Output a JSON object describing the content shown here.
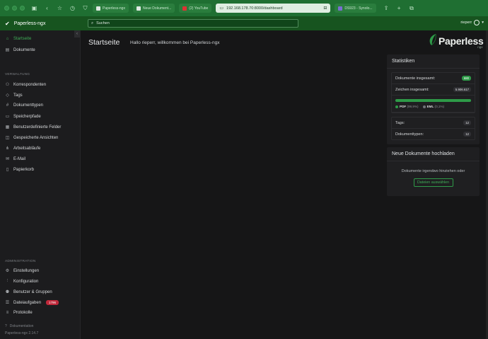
{
  "browser": {
    "tabs": [
      {
        "label": "Paperless-ngx",
        "kind": "paperless"
      },
      {
        "label": "Neue Dokument...",
        "kind": "doc"
      },
      {
        "label": "(2) YouTube",
        "kind": "youtube"
      }
    ],
    "url": "192.168.178.70:8000/dashboard",
    "last_tab": {
      "label": "DS923 - Synolo...",
      "kind": "syno"
    }
  },
  "header": {
    "app_title": "Paperless-ngx",
    "search_placeholder": "Suchen",
    "user": "rieperr"
  },
  "sidebar": {
    "main_items": [
      {
        "label": "Startseite",
        "icon": "home-icon",
        "active": true
      },
      {
        "label": "Dokumente",
        "icon": "documents-icon",
        "active": false
      }
    ],
    "verwaltung_label": "VERWALTUNG",
    "verwaltung_items": [
      {
        "label": "Korrespondenten",
        "icon": "person-icon"
      },
      {
        "label": "Tags",
        "icon": "tag-icon"
      },
      {
        "label": "Dokumenttypen",
        "icon": "hash-icon"
      },
      {
        "label": "Speicherpfade",
        "icon": "folder-icon"
      },
      {
        "label": "Benutzerdefinierte Felder",
        "icon": "fields-icon"
      },
      {
        "label": "Gespeicherte Ansichten",
        "icon": "views-icon"
      },
      {
        "label": "Arbeitsabläufe",
        "icon": "workflow-icon"
      },
      {
        "label": "E-Mail",
        "icon": "mail-icon"
      },
      {
        "label": "Papierkorb",
        "icon": "trash-icon"
      }
    ],
    "administration_label": "ADMINISTRATION",
    "admin_items": [
      {
        "label": "Einstellungen",
        "icon": "gear-icon"
      },
      {
        "label": "Konfiguration",
        "icon": "sliders-icon"
      },
      {
        "label": "Benutzer & Gruppen",
        "icon": "users-icon"
      },
      {
        "label": "Dateiaufgaben",
        "icon": "tasks-icon",
        "badge": "1796"
      },
      {
        "label": "Protokolle",
        "icon": "logs-icon"
      }
    ],
    "footer_docs": "Dokumentation",
    "footer_version": "Paperless-ngx 2.14.7"
  },
  "main": {
    "title": "Startseite",
    "welcome": "Hallo rieperr, willkommen bei Paperless-ngx",
    "brand_name": "Paperless",
    "brand_sub": "ngx"
  },
  "stats": {
    "title": "Statistiken",
    "documents_label": "Dokumente insgesamt:",
    "documents_value": "680",
    "chars_label": "Zeichen insgesamt:",
    "chars_value": "5.906.617",
    "progress_fraction": 0.999,
    "legend": [
      {
        "type": "PDF",
        "pct": "(99,9%)",
        "color": "#2e9a48"
      },
      {
        "type": "EML",
        "pct": "(0,1%)",
        "color": "#6f7378"
      }
    ],
    "tags_label": "Tags:",
    "tags_value": "12",
    "doctypes_label": "Dokumenttypen:",
    "doctypes_value": "12"
  },
  "upload": {
    "title": "Neue Dokumente hochladen",
    "hint": "Dokumente irgendwo hinziehen oder",
    "button": "Dateien auswählen"
  }
}
